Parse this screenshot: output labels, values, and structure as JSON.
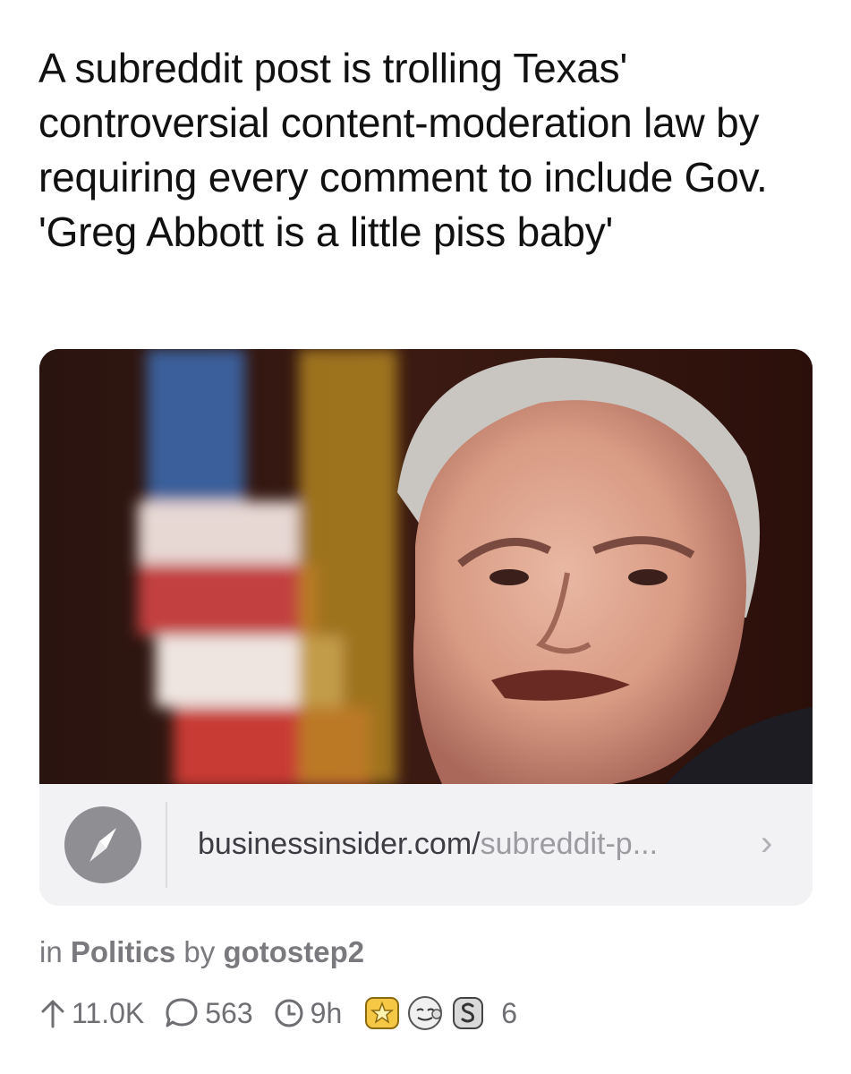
{
  "post": {
    "title": "A subreddit post is trolling Texas' controversial content-moderation law by requiring every comment to include Gov. 'Greg Abbott is a little piss baby'"
  },
  "link": {
    "domain": "businessinsider.com/",
    "path": "subreddit-p...",
    "icon": "safari-compass-icon",
    "chevron": "›"
  },
  "meta": {
    "in_label": "in",
    "subreddit": "Politics",
    "by_label": "by",
    "author": "gotostep2"
  },
  "stats": {
    "upvotes": "11.0K",
    "comments": "563",
    "age": "9h",
    "award_count": "6"
  },
  "colors": {
    "accent_gray": "#8e8e93",
    "card_bg": "#f2f2f4",
    "meta_text": "#7a7a7e"
  }
}
